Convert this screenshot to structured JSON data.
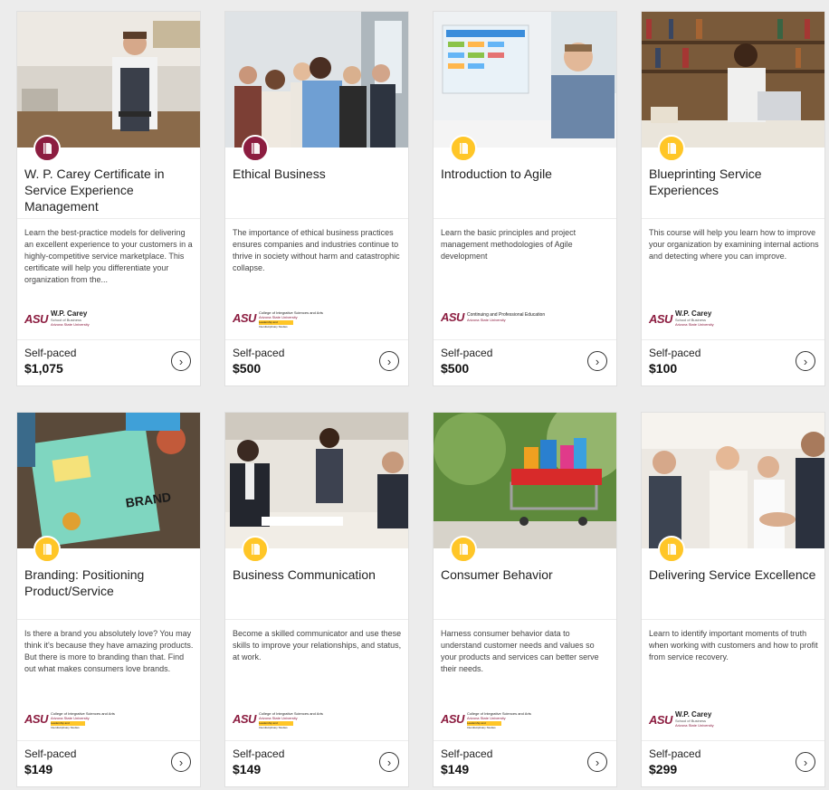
{
  "courses": [
    {
      "title": "W. P. Carey Certificate in Service Experience Management",
      "description": "Learn the best-practice models for delivering an excellent experience to your customers in a highly-competitive service marketplace. This certificate will help you differentiate your organization from the...",
      "badge": "maroon",
      "logo_type": "wpcarey",
      "logo_main": "W.P. Carey",
      "logo_sub": "School of Business",
      "logo_uni": "Arizona State University",
      "pace": "Self-paced",
      "price": "$1,075",
      "image": "cafe-server"
    },
    {
      "title": "Ethical Business",
      "description": "The importance of ethical business practices ensures companies and industries continue to thrive in society without harm and catastrophic collapse.",
      "badge": "maroon",
      "logo_type": "integrative",
      "logo_main": "College of Integrative Sciences and Arts",
      "logo_sub": "Arizona State University",
      "logo_uni": "Leadership and Interdisciplinary Studies",
      "pace": "Self-paced",
      "price": "$500",
      "image": "business-team"
    },
    {
      "title": "Introduction to Agile",
      "description": "Learn the basic principles and project management methodologies of Agile development",
      "badge": "gold",
      "logo_type": "continuing",
      "logo_main": "Continuing and Professional Education",
      "logo_sub": "Arizona State University",
      "logo_uni": "",
      "pace": "Self-paced",
      "price": "$500",
      "image": "agile-desk"
    },
    {
      "title": "Blueprinting Service Experiences",
      "description": "This course will help you learn how to improve your organization by examining internal actions and detecting where you can improve.",
      "badge": "gold",
      "logo_type": "wpcarey",
      "logo_main": "W.P. Carey",
      "logo_sub": "School of Business",
      "logo_uni": "Arizona State University",
      "pace": "Self-paced",
      "price": "$100",
      "image": "library"
    },
    {
      "title": "Branding: Positioning Product/Service",
      "description": "Is there a brand you absolutely love? You may think it's because they have amazing products. But there is more to branding than that. Find out what makes consumers love brands.",
      "badge": "gold",
      "logo_type": "integrative",
      "logo_main": "College of Integrative Sciences and Arts",
      "logo_sub": "Arizona State University",
      "logo_uni": "Leadership and Interdisciplinary Studies",
      "pace": "Self-paced",
      "price": "$149",
      "image": "branding-table"
    },
    {
      "title": "Business Communication",
      "description": "Become a skilled communicator and use these skills to improve your relationships, and status, at work.",
      "badge": "gold",
      "logo_type": "integrative",
      "logo_main": "College of Integrative Sciences and Arts",
      "logo_sub": "Arizona State University",
      "logo_uni": "Leadership and Interdisciplinary Studies",
      "pace": "Self-paced",
      "price": "$149",
      "image": "meeting"
    },
    {
      "title": "Consumer Behavior",
      "description": "Harness consumer behavior data to understand customer needs and values so your products and services can better serve their needs.",
      "badge": "gold",
      "logo_type": "integrative",
      "logo_main": "College of Integrative Sciences and Arts",
      "logo_sub": "Arizona State University",
      "logo_uni": "Leadership and Interdisciplinary Studies",
      "pace": "Self-paced",
      "price": "$149",
      "image": "shopping-cart"
    },
    {
      "title": "Delivering Service Excellence",
      "description": "Learn to identify important moments of truth when working with customers and how to profit from service recovery.",
      "badge": "gold",
      "logo_type": "wpcarey",
      "logo_main": "W.P. Carey",
      "logo_sub": "School of Business",
      "logo_uni": "Arizona State University",
      "pace": "Self-paced",
      "price": "$299",
      "image": "handshake"
    }
  ],
  "colors": {
    "asu_maroon": "#8c1d40",
    "asu_gold": "#ffc627",
    "background": "#ececec"
  }
}
